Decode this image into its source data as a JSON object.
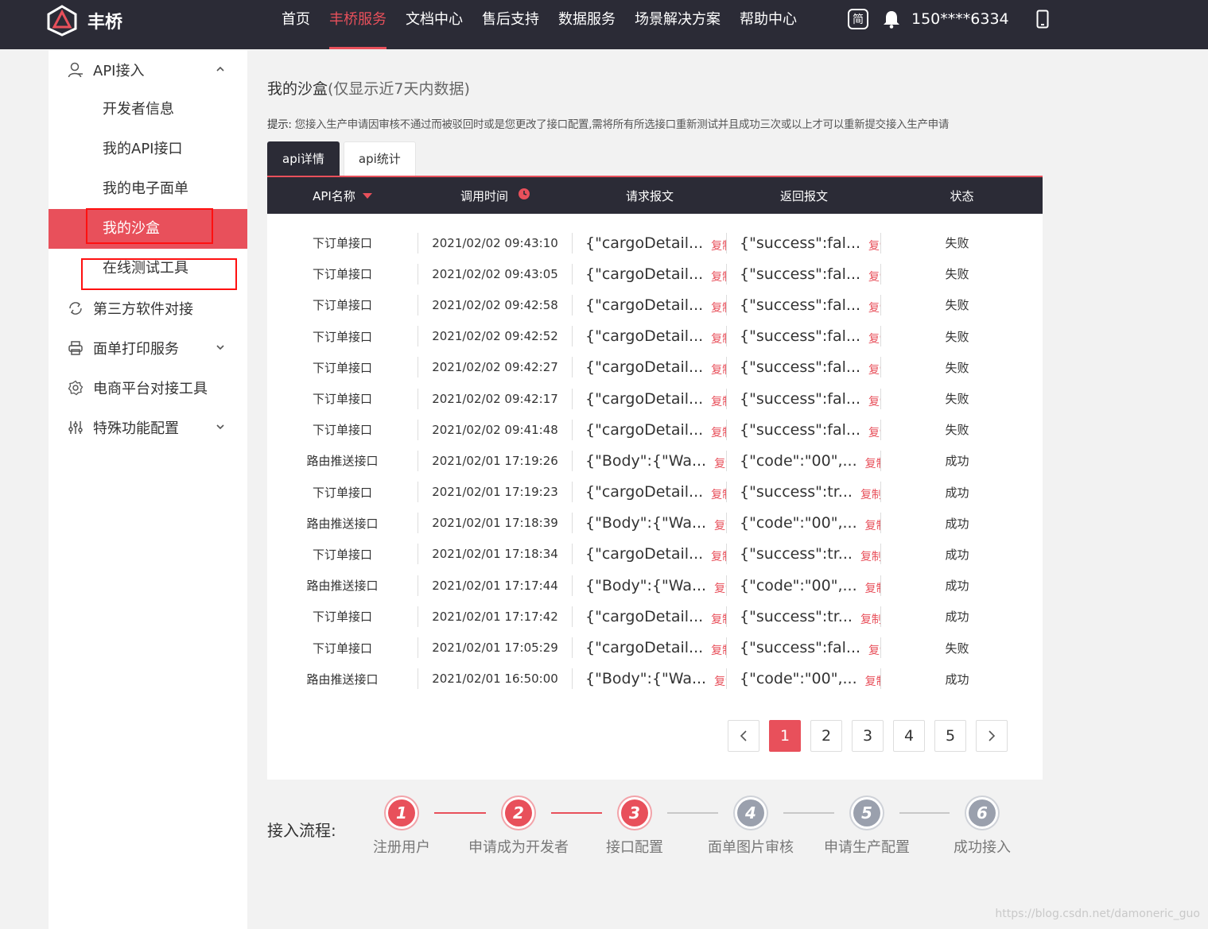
{
  "app": {
    "brand": "丰桥"
  },
  "nav": {
    "items": [
      "首页",
      "丰桥服务",
      "文档中心",
      "售后支持",
      "数据服务",
      "场景解决方案",
      "帮助中心"
    ],
    "active_index": 1
  },
  "topbar": {
    "lang_badge": "简",
    "user_phone": "150****6334"
  },
  "sidebar": {
    "group_api": "API接入",
    "sub_items": [
      "开发者信息",
      "我的API接口",
      "我的电子面单",
      "我的沙盒",
      "在线测试工具"
    ],
    "active_sub_index": 3,
    "groups": [
      "第三方软件对接",
      "面单打印服务",
      "电商平台对接工具",
      "特殊功能配置"
    ]
  },
  "main": {
    "title": "我的沙盒",
    "title_note": "(仅显示近7天内数据)",
    "tip_label": "提示:",
    "tip_text": "您接入生产申请因审核不通过而被驳回时或是您更改了接口配置,需将所有所选接口重新测试并且成功三次或以上才可以重新提交接入生产申请",
    "tabs": [
      "api详情",
      "api统计"
    ],
    "active_tab": 0
  },
  "table": {
    "columns": [
      "API名称",
      "调用时间",
      "请求报文",
      "返回报文",
      "状态"
    ],
    "copy_label": "复制",
    "rows": [
      {
        "name": "下订单接口",
        "time": "2021/02/02 09:43:10",
        "req": "{\"cargoDetail...",
        "resp": "{\"success\":fal...",
        "status": "失败"
      },
      {
        "name": "下订单接口",
        "time": "2021/02/02 09:43:05",
        "req": "{\"cargoDetail...",
        "resp": "{\"success\":fal...",
        "status": "失败"
      },
      {
        "name": "下订单接口",
        "time": "2021/02/02 09:42:58",
        "req": "{\"cargoDetail...",
        "resp": "{\"success\":fal...",
        "status": "失败"
      },
      {
        "name": "下订单接口",
        "time": "2021/02/02 09:42:52",
        "req": "{\"cargoDetail...",
        "resp": "{\"success\":fal...",
        "status": "失败"
      },
      {
        "name": "下订单接口",
        "time": "2021/02/02 09:42:27",
        "req": "{\"cargoDetail...",
        "resp": "{\"success\":fal...",
        "status": "失败"
      },
      {
        "name": "下订单接口",
        "time": "2021/02/02 09:42:17",
        "req": "{\"cargoDetail...",
        "resp": "{\"success\":fal...",
        "status": "失败"
      },
      {
        "name": "下订单接口",
        "time": "2021/02/02 09:41:48",
        "req": "{\"cargoDetail...",
        "resp": "{\"success\":fal...",
        "status": "失败"
      },
      {
        "name": "路由推送接口",
        "time": "2021/02/01 17:19:26",
        "req": "{\"Body\":{\"Wa...",
        "resp": "{\"code\":\"00\",...",
        "status": "成功"
      },
      {
        "name": "下订单接口",
        "time": "2021/02/01 17:19:23",
        "req": "{\"cargoDetail...",
        "resp": "{\"success\":tr...",
        "status": "成功"
      },
      {
        "name": "路由推送接口",
        "time": "2021/02/01 17:18:39",
        "req": "{\"Body\":{\"Wa...",
        "resp": "{\"code\":\"00\",...",
        "status": "成功"
      },
      {
        "name": "下订单接口",
        "time": "2021/02/01 17:18:34",
        "req": "{\"cargoDetail...",
        "resp": "{\"success\":tr...",
        "status": "成功"
      },
      {
        "name": "路由推送接口",
        "time": "2021/02/01 17:17:44",
        "req": "{\"Body\":{\"Wa...",
        "resp": "{\"code\":\"00\",...",
        "status": "成功"
      },
      {
        "name": "下订单接口",
        "time": "2021/02/01 17:17:42",
        "req": "{\"cargoDetail...",
        "resp": "{\"success\":tr...",
        "status": "成功"
      },
      {
        "name": "下订单接口",
        "time": "2021/02/01 17:05:29",
        "req": "{\"cargoDetail...",
        "resp": "{\"success\":fal...",
        "status": "失败"
      },
      {
        "name": "路由推送接口",
        "time": "2021/02/01 16:50:00",
        "req": "{\"Body\":{\"Wa...",
        "resp": "{\"code\":\"00\",...",
        "status": "成功"
      }
    ]
  },
  "pagination": {
    "pages": [
      "1",
      "2",
      "3",
      "4",
      "5"
    ],
    "current": "1"
  },
  "process": {
    "label": "接入流程:",
    "steps": [
      {
        "num": "1",
        "label": "注册用户",
        "done": true
      },
      {
        "num": "2",
        "label": "申请成为开发者",
        "done": true
      },
      {
        "num": "3",
        "label": "接口配置",
        "done": true
      },
      {
        "num": "4",
        "label": "面单图片审核",
        "done": false
      },
      {
        "num": "5",
        "label": "申请生产配置",
        "done": false
      },
      {
        "num": "6",
        "label": "成功接入",
        "done": false
      }
    ]
  },
  "colors": {
    "accent": "#e8505b",
    "dark": "#2b2b36"
  },
  "watermark": "https://blog.csdn.net/damoneric_guo"
}
